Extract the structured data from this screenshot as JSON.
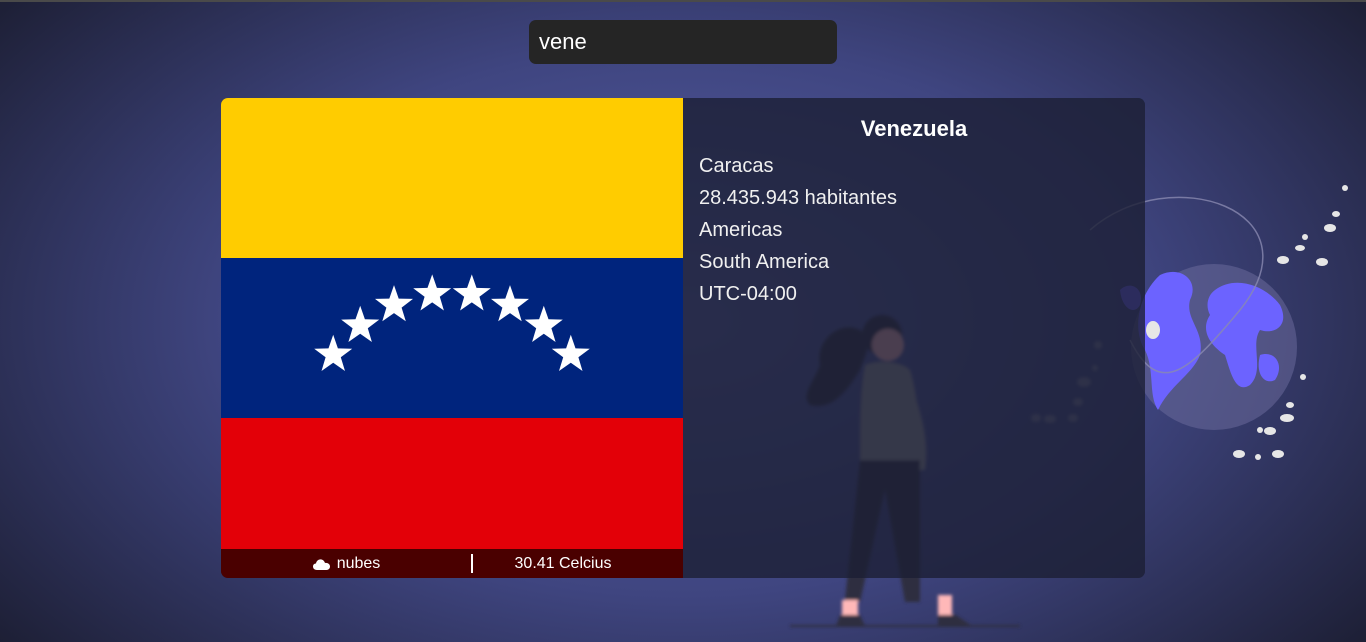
{
  "search": {
    "value": "vene"
  },
  "country": {
    "name": "Venezuela",
    "capital": "Caracas",
    "population": "28.435.943 habitantes",
    "region": "Americas",
    "subregion": "South America",
    "timezone": "UTC-04:00"
  },
  "weather": {
    "icon": "cloud-icon",
    "description": "nubes",
    "temperature": "30.41 Celcius"
  },
  "colors": {
    "flag_yellow": "#ffcc00",
    "flag_blue": "#00247d",
    "flag_red": "#e30008",
    "weather_bar": "#4a0000",
    "globe_accent": "#6c63ff"
  }
}
